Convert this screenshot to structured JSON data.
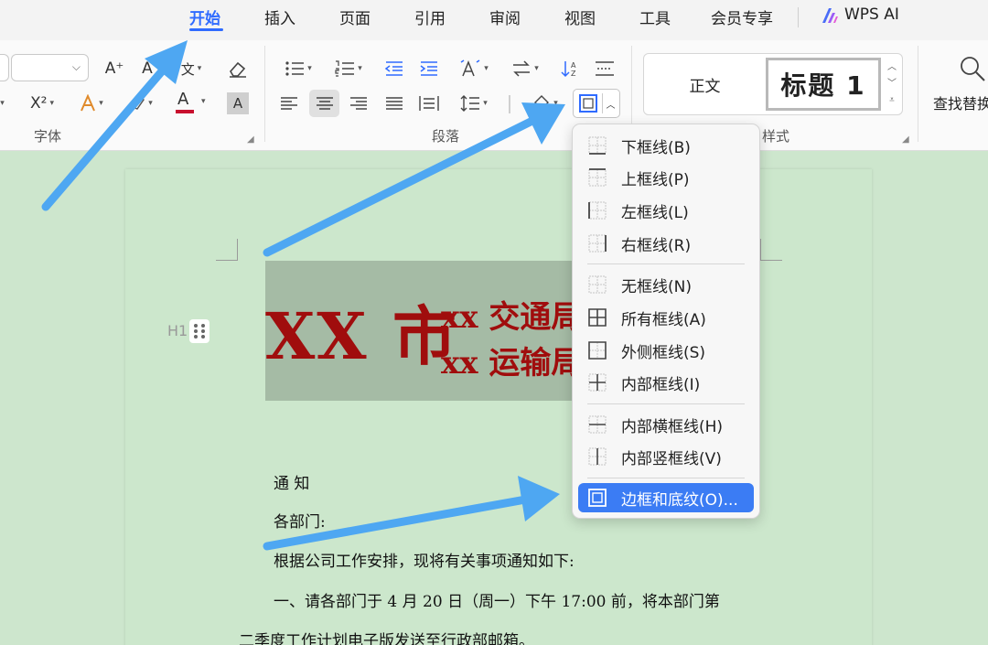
{
  "tabs": [
    {
      "label": "开始",
      "active": true
    },
    {
      "label": "插入",
      "active": false
    },
    {
      "label": "页面",
      "active": false
    },
    {
      "label": "引用",
      "active": false
    },
    {
      "label": "审阅",
      "active": false
    },
    {
      "label": "视图",
      "active": false
    },
    {
      "label": "工具",
      "active": false
    },
    {
      "label": "会员专享",
      "active": false
    },
    {
      "label": "WPS AI",
      "active": false
    }
  ],
  "ribbon": {
    "font_group_label": "字体",
    "paragraph_group_label": "段落",
    "styles_group_label": "样式",
    "style_normal_label": "正文",
    "style_heading_label": "标题 1",
    "find_replace_label": "查找替换",
    "font_glyphs": {
      "increase": "A⁺",
      "superscript": "X²",
      "font_color": "A",
      "shading": "A"
    }
  },
  "document": {
    "heading_marker": "H1",
    "banner_big": "XX 市",
    "banner_line1": "xx 交通局",
    "banner_line2": "xx 运输局",
    "lines": [
      "通  知",
      "各部门:",
      "根据公司工作安排，现将有关事项通知如下:",
      "一、请各部门于 4 月 20 日（周一）下午 17:00 前，将本部门第",
      "二季度工作计划电子版发送至行政部邮箱。"
    ]
  },
  "border_menu": {
    "items": [
      {
        "label": "下框线(B)",
        "icon": "bottom-border-icon"
      },
      {
        "label": "上框线(P)",
        "icon": "top-border-icon"
      },
      {
        "label": "左框线(L)",
        "icon": "left-border-icon"
      },
      {
        "label": "右框线(R)",
        "icon": "right-border-icon"
      },
      {
        "label": "无框线(N)",
        "icon": "no-border-icon"
      },
      {
        "label": "所有框线(A)",
        "icon": "all-borders-icon"
      },
      {
        "label": "外侧框线(S)",
        "icon": "outside-borders-icon"
      },
      {
        "label": "内部框线(I)",
        "icon": "inside-borders-icon"
      },
      {
        "label": "内部横框线(H)",
        "icon": "inside-horizontal-border-icon"
      },
      {
        "label": "内部竖框线(V)",
        "icon": "inside-vertical-border-icon"
      },
      {
        "label": "边框和底纹(O)...",
        "icon": "borders-shading-icon",
        "selected": true
      }
    ]
  },
  "colors": {
    "accent": "#2f6bff",
    "menu_selected": "#3b7cf4",
    "banner_red": "#a00d0d",
    "page_background": "#cce7cc",
    "annotation_arrow": "#4ea7f2"
  }
}
